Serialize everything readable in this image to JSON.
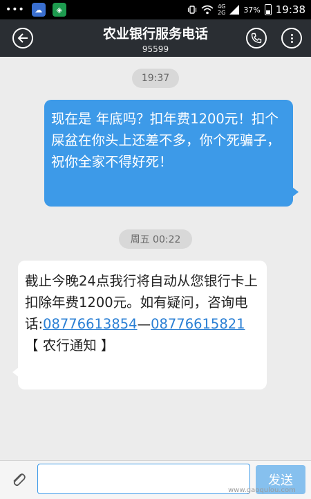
{
  "status_bar": {
    "dots": "•••",
    "network": "4G",
    "network_sub": "2G",
    "battery": "37%",
    "time": "19:38"
  },
  "header": {
    "title": "农业银行服务电话",
    "number": "95599"
  },
  "messages": {
    "timestamp_1": "19:37",
    "sent_text": "现在是 年底吗？扣年费1200元！扣个屎盆在你头上还差不多，你个死骗子，祝你全家不得好死！",
    "timestamp_2": "周五 00:22",
    "received_text_1": "截止今晚24点我行将自动从您银行卡上扣除年费1200元。如有疑问，咨询电话:",
    "received_phone_1": "08776613854",
    "received_dash": "—",
    "received_phone_2": "08776615821",
    "received_text_2": "【 农行通知 】"
  },
  "input": {
    "value": "",
    "send_label": "发送"
  },
  "watermark": "www.gaoqulou.com"
}
